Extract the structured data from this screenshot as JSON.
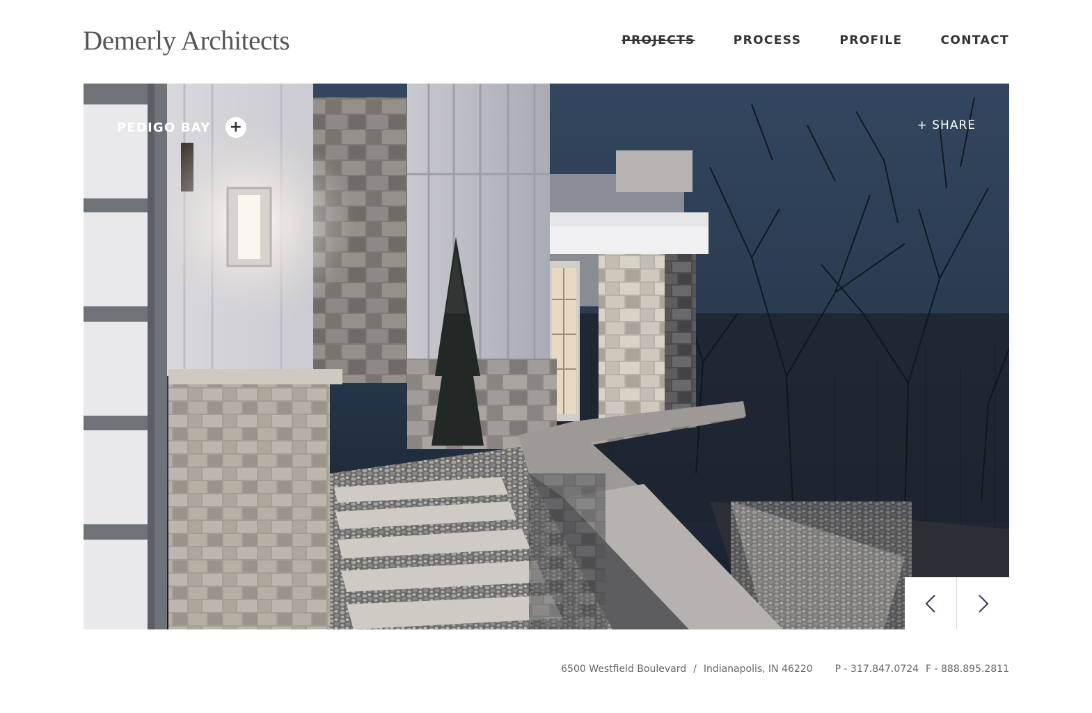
{
  "header": {
    "logo": "Demerly Architects",
    "nav": [
      {
        "label": "PROJECTS",
        "active": true
      },
      {
        "label": "PROCESS",
        "active": false
      },
      {
        "label": "PROFILE",
        "active": false
      },
      {
        "label": "CONTACT",
        "active": false
      }
    ]
  },
  "hero": {
    "project_title": "PEDIGO BAY",
    "expand_icon": "plus-icon",
    "share_label": "+ SHARE",
    "prev_icon": "chevron-left-icon",
    "next_icon": "chevron-right-icon",
    "image_subject": "night exterior of stone house with lit walkway and bare trees"
  },
  "footer": {
    "street": "6500 Westfield Boulevard",
    "separator": "/",
    "city": "Indianapolis, IN 46220",
    "phone": "P - 317.847.0724",
    "fax": "F - 888.895.2811"
  },
  "colors": {
    "text": "#333333",
    "footer_text": "#666666",
    "sky": "#2a3c55",
    "stone": "#9a9590"
  }
}
